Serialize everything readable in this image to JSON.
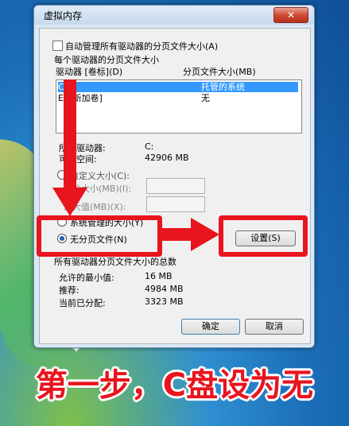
{
  "dialog": {
    "title": "虚拟内存",
    "close_label": "✕",
    "auto_manage_label": "自动管理所有驱动器的分页文件大小(A)",
    "group_label": "每个驱动器的分页文件大小",
    "col_drive": "驱动器 [卷标](D)",
    "col_size": "分页文件大小(MB)",
    "drives": [
      {
        "drive": "C:",
        "size": "托管的系统"
      },
      {
        "drive": "E:    [新加卷]",
        "size": "无"
      }
    ],
    "selected_drive_label": "所选驱动器:",
    "selected_drive_value": "C:",
    "free_space_label": "可用空间:",
    "free_space_value": "42906 MB",
    "custom_size_label": "自定义大小(C):",
    "initial_size_label": "初始大小(MB)(I):",
    "max_size_label": "最大值(MB)(X):",
    "system_managed_label": "系统管理的大小(Y)",
    "no_paging_label": "无分页文件(N)",
    "set_button": "设置(S)",
    "total_group_label": "所有驱动器分页文件大小的总数",
    "min_allowed_label": "允许的最小值:",
    "min_allowed_value": "16 MB",
    "recommended_label": "推荐:",
    "recommended_value": "4984 MB",
    "allocated_label": "当前已分配:",
    "allocated_value": "3323 MB",
    "ok_button": "确定",
    "cancel_button": "取消"
  },
  "caption": "第一步，C盘设为无",
  "colors": {
    "annotation": "#e8141e",
    "selection": "#3399ff"
  }
}
